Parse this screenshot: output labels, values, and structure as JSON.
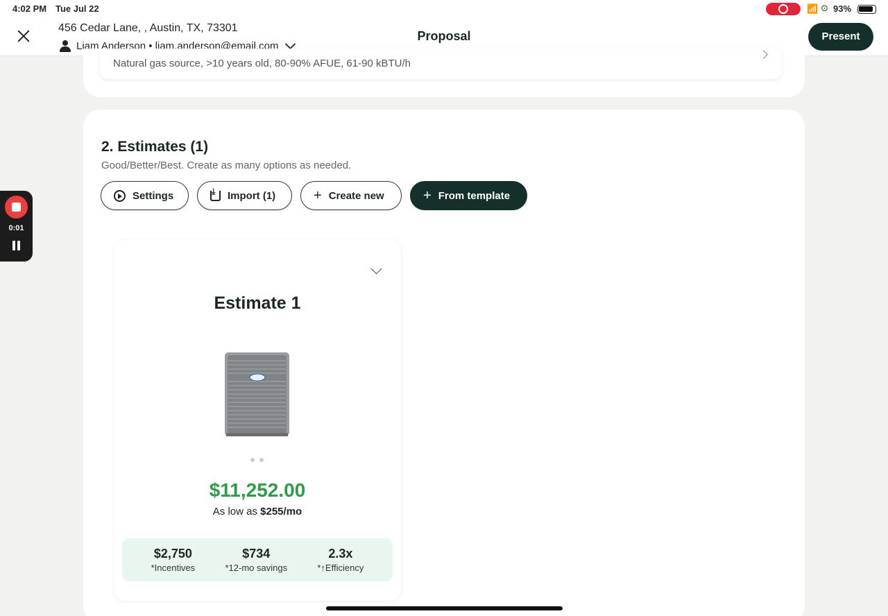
{
  "status_bar": {
    "time": "4:02 PM",
    "date": "Tue Jul 22",
    "battery_pct": "93%",
    "battery_level": 0.93
  },
  "header": {
    "address": "456 Cedar Lane, , Austin, TX, 73301",
    "customer": "Liam Anderson • liam.anderson@email.com",
    "title": "Proposal",
    "present_label": "Present"
  },
  "equipment_summary": {
    "description": "Natural gas source, >10 years old, 80-90% AFUE, 61-90 kBTU/h"
  },
  "estimates": {
    "title": "2. Estimates (1)",
    "subtitle": "Good/Better/Best. Create as many options as needed.",
    "buttons": {
      "settings": "Settings",
      "import": "Import (1)",
      "create_new": "Create new",
      "from_template": "From template"
    },
    "items": [
      {
        "name": "Estimate 1",
        "price": "$11,252.00",
        "monthly_prefix": "As low as ",
        "monthly_amount": "$255/mo",
        "stats": [
          {
            "value": "$2,750",
            "label": "*Incentives"
          },
          {
            "value": "$734",
            "label": "*12-mo savings"
          },
          {
            "value": "2.3x",
            "label": "*↑Efficiency"
          }
        ]
      }
    ]
  },
  "recorder": {
    "elapsed": "0:01"
  },
  "colors": {
    "primary_dark": "#15302a",
    "price_green": "#2f9a4a",
    "stats_bg": "#e8f6ef",
    "record_red": "#ef3e3e"
  }
}
